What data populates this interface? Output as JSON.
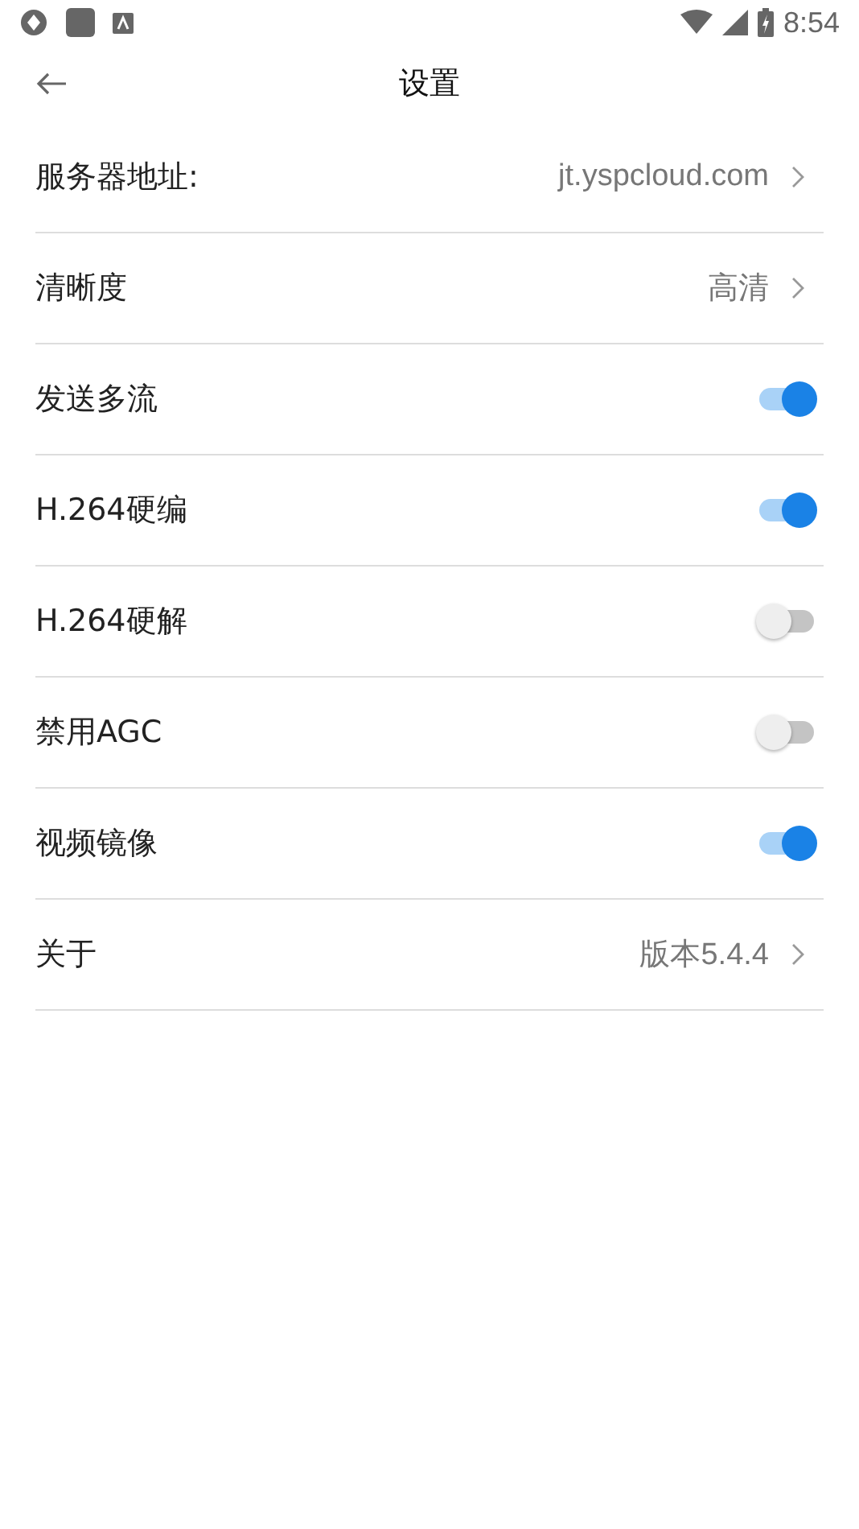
{
  "status_bar": {
    "time": "8:54"
  },
  "header": {
    "title": "设置"
  },
  "rows": [
    {
      "kind": "link",
      "label": "服务器地址:",
      "value": "jt.yspcloud.com"
    },
    {
      "kind": "link",
      "label": "清晰度",
      "value": "高清"
    },
    {
      "kind": "toggle",
      "label": "发送多流",
      "on": true
    },
    {
      "kind": "toggle",
      "label": "H.264硬编",
      "on": true
    },
    {
      "kind": "toggle",
      "label": "H.264硬解",
      "on": false
    },
    {
      "kind": "toggle",
      "label": "禁用AGC",
      "on": false
    },
    {
      "kind": "toggle",
      "label": "视频镜像",
      "on": true
    },
    {
      "kind": "link",
      "label": "关于",
      "value": "版本5.4.4"
    }
  ]
}
